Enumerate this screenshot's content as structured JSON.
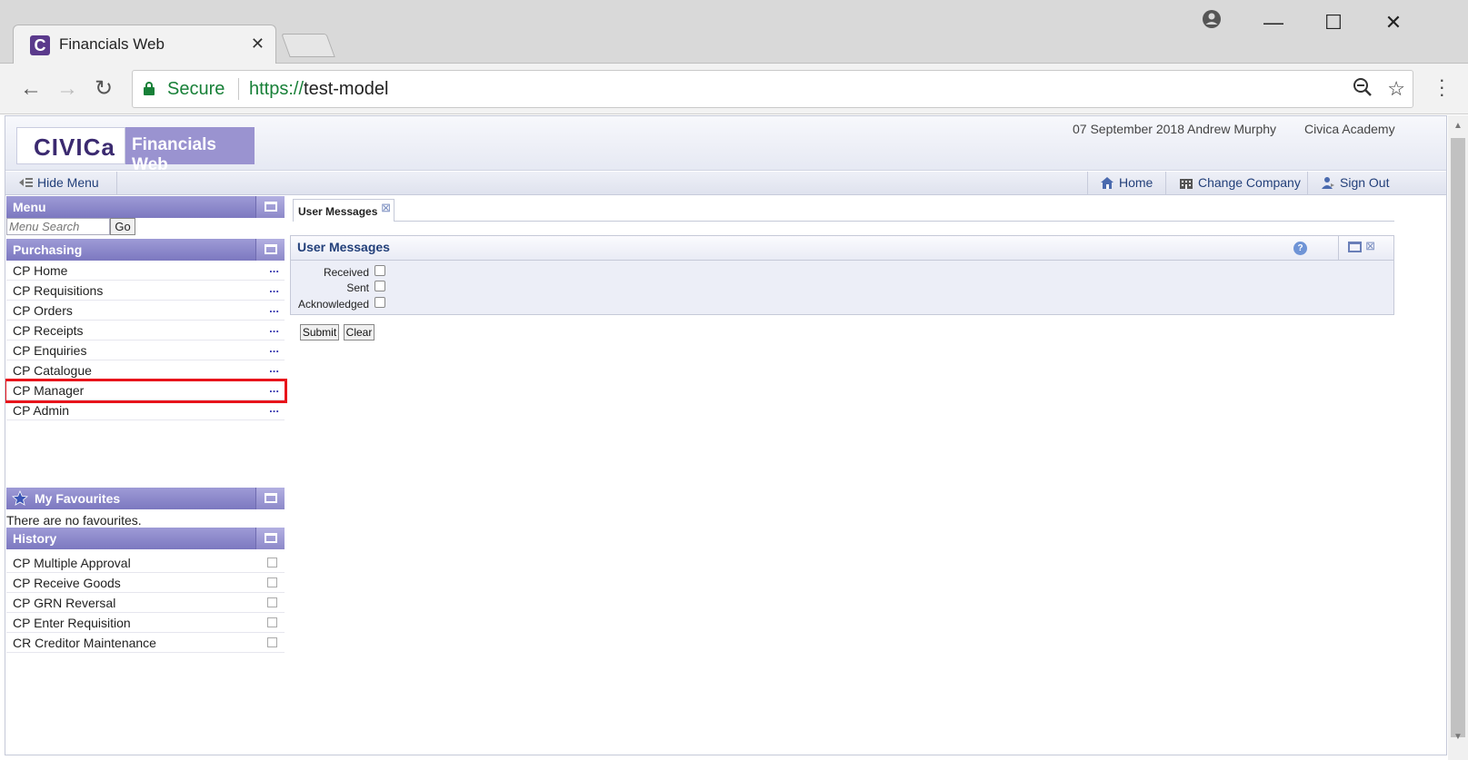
{
  "browser": {
    "tab_title": "Financials Web",
    "favicon_letter": "C",
    "secure_label": "Secure",
    "url_scheme": "https://",
    "url_host": "test-model"
  },
  "header": {
    "logo_text": "CIVICa",
    "brand_title": "Financials Web",
    "date": "07 September 2018",
    "user": "Andrew Murphy",
    "company": "Civica Academy"
  },
  "menubar": {
    "hide_menu": "Hide Menu",
    "home": "Home",
    "change_company": "Change Company",
    "sign_out": "Sign Out"
  },
  "sidebar": {
    "menu_title": "Menu",
    "search_placeholder": "Menu Search",
    "go_label": "Go",
    "purchasing_title": "Purchasing",
    "purchasing_items": [
      {
        "label": "CP Home",
        "more": "..."
      },
      {
        "label": "CP Requisitions",
        "more": "..."
      },
      {
        "label": "CP Orders",
        "more": "..."
      },
      {
        "label": "CP Receipts",
        "more": "..."
      },
      {
        "label": "CP Enquiries",
        "more": "..."
      },
      {
        "label": "CP Catalogue",
        "more": "..."
      },
      {
        "label": "CP Manager",
        "more": "..."
      },
      {
        "label": "CP Admin",
        "more": "..."
      }
    ],
    "favourites_title": "My Favourites",
    "favourites_empty": "There are no favourites.",
    "history_title": "History",
    "history_items": [
      {
        "label": "CP Multiple Approval"
      },
      {
        "label": "CP Receive Goods"
      },
      {
        "label": "CP GRN Reversal"
      },
      {
        "label": "CP Enter Requisition"
      },
      {
        "label": "CR Creditor Maintenance"
      }
    ]
  },
  "main": {
    "tab_label": "User Messages",
    "panel_title": "User Messages",
    "help_glyph": "?",
    "filters": [
      {
        "label": "Received",
        "checked": false
      },
      {
        "label": "Sent",
        "checked": false
      },
      {
        "label": "Acknowledged",
        "checked": false
      }
    ],
    "submit_label": "Submit",
    "clear_label": "Clear"
  },
  "highlight": {
    "target": "CP Manager",
    "color": "#e8141b"
  }
}
